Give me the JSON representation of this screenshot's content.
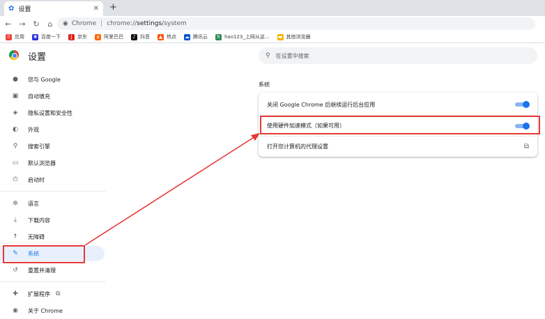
{
  "tab": {
    "title": "设置",
    "icon": "gear-icon"
  },
  "toolbar": {
    "site_label": "Chrome",
    "url_prefix": "chrome://",
    "url_path": "settings",
    "url_suffix": "/system"
  },
  "bookmarks": [
    {
      "label": "应用",
      "icon": "apps-icon",
      "color": "#ea4335"
    },
    {
      "label": "百度一下",
      "icon": "paw-icon",
      "color": "#2932e1"
    },
    {
      "label": "京东",
      "icon": "jd-icon",
      "color": "#e1251b"
    },
    {
      "label": "阿里巴巴",
      "icon": "alibaba-icon",
      "color": "#ff6a00"
    },
    {
      "label": "抖音",
      "icon": "douyin-icon",
      "color": "#111111"
    },
    {
      "label": "热点",
      "icon": "flame-icon",
      "color": "#ff4d00"
    },
    {
      "label": "腾讯云",
      "icon": "cloud-icon",
      "color": "#0052d9"
    },
    {
      "label": "hao123_上网从这...",
      "icon": "hao123-icon",
      "color": "#2e8b57"
    },
    {
      "label": "其他浏览器",
      "icon": "folder-icon",
      "color": "#f4b400"
    }
  ],
  "header": {
    "title": "设置",
    "search_placeholder": "在设置中搜索"
  },
  "sidebar": {
    "items": [
      {
        "label": "您与 Google",
        "icon": "person-icon",
        "glyph": "👤"
      },
      {
        "label": "自动填充",
        "icon": "clipboard-icon",
        "glyph": "▣"
      },
      {
        "label": "隐私设置和安全性",
        "icon": "shield-icon",
        "glyph": "◈"
      },
      {
        "label": "外观",
        "icon": "palette-icon",
        "glyph": "◐"
      },
      {
        "label": "搜索引擎",
        "icon": "search-icon",
        "glyph": "⚲"
      },
      {
        "label": "默认浏览器",
        "icon": "browser-icon",
        "glyph": "▭"
      },
      {
        "label": "启动时",
        "icon": "power-icon",
        "glyph": "⏻"
      },
      {
        "label": "语言",
        "icon": "globe-icon",
        "glyph": "⊕"
      },
      {
        "label": "下载内容",
        "icon": "download-icon",
        "glyph": "⤓"
      },
      {
        "label": "无障碍",
        "icon": "accessibility-icon",
        "glyph": "☨"
      },
      {
        "label": "系统",
        "icon": "wrench-icon",
        "glyph": "🔧"
      },
      {
        "label": "重置并清理",
        "icon": "reset-icon",
        "glyph": "↺"
      },
      {
        "label": "扩展程序",
        "icon": "puzzle-icon",
        "glyph": "✚"
      },
      {
        "label": "关于 Chrome",
        "icon": "chrome-icon",
        "glyph": "◉"
      }
    ]
  },
  "main": {
    "section_title": "系统",
    "rows": [
      {
        "label": "关闭 Google Chrome 后继续运行后台应用",
        "toggle_on": true
      },
      {
        "label": "使用硬件加速模式（如果可用）",
        "toggle_on": true
      },
      {
        "label": "打开您计算机的代理设置",
        "icon": "open-external-icon"
      }
    ]
  },
  "annotation_color": "#e53935",
  "accent_color": "#1a73e8"
}
